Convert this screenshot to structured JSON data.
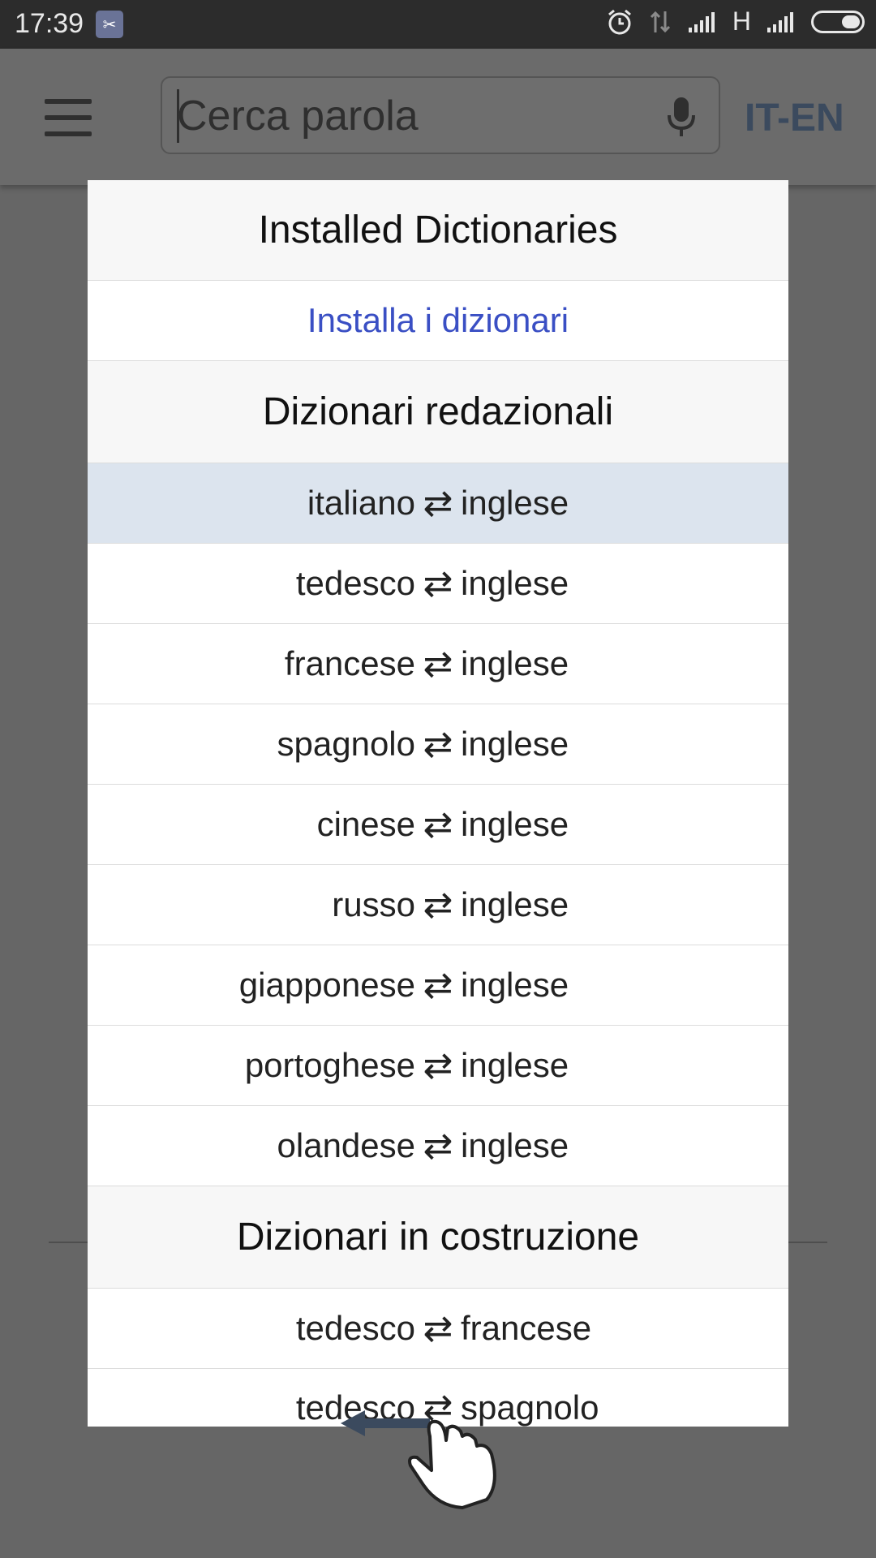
{
  "status_bar": {
    "time": "17:39",
    "network_type": "H",
    "icons": [
      "notification-icon",
      "alarm-icon",
      "data-arrows-icon",
      "signal-icon",
      "signal-icon",
      "battery-icon"
    ]
  },
  "app_bar": {
    "menu_icon": "hamburger-icon",
    "search_placeholder": "Cerca parola",
    "mic_icon": "mic-icon",
    "language_pair": "IT-EN"
  },
  "dialog": {
    "title": "Installed Dictionaries",
    "install_link": "Installa i dizionari",
    "section_editorial": "Dizionari redazionali",
    "arrow": "⇄",
    "editorial_items": [
      {
        "left": "italiano",
        "right": "inglese",
        "selected": true
      },
      {
        "left": "tedesco",
        "right": "inglese"
      },
      {
        "left": "francese",
        "right": "inglese"
      },
      {
        "left": "spagnolo",
        "right": "inglese"
      },
      {
        "left": "cinese",
        "right": "inglese"
      },
      {
        "left": "russo",
        "right": "inglese"
      },
      {
        "left": "giapponese",
        "right": "inglese"
      },
      {
        "left": "portoghese",
        "right": "inglese"
      },
      {
        "left": "olandese",
        "right": "inglese"
      }
    ],
    "section_in_progress": "Dizionari in costruzione",
    "in_progress_items": [
      {
        "left": "tedesco",
        "right": "francese"
      },
      {
        "left": "tedesco",
        "right": "spagnolo"
      }
    ]
  },
  "colors": {
    "overlay": "#666666",
    "selected_row": "#dce4ee",
    "link": "#3a4fc4",
    "language_pair": "#3b4a5e"
  }
}
